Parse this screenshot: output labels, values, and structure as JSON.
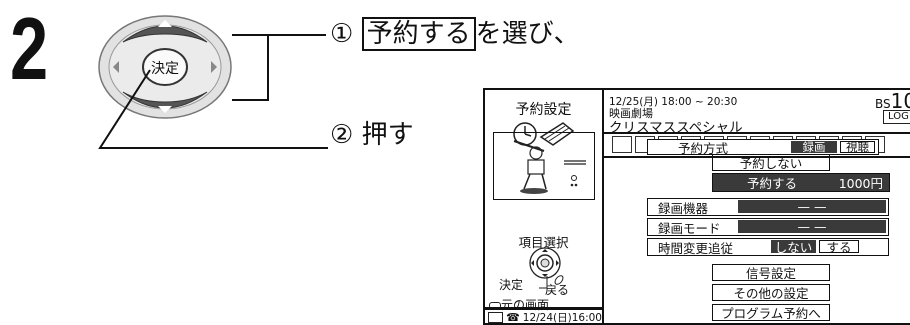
{
  "step": {
    "number": "2"
  },
  "remote": {
    "enter_label": "決定"
  },
  "instructions": {
    "line1_prefix": "①",
    "line1_boxed": "予約する",
    "line1_suffix": "を選び、",
    "line2": "② 押す"
  },
  "screen": {
    "left_title": "予約設定",
    "program": {
      "datetime": "12/25(月) 18:00 ~ 20:30",
      "genre": "映画劇場",
      "title": "クリスマススペシャル",
      "channel_prefix": "BS",
      "channel_number": "10",
      "logo": "LOG"
    },
    "side": {
      "select_label": "項目選択",
      "enter_label": "決定",
      "back_label": "戻る",
      "prev_screen": "元の画面",
      "status_time": "12/24(日)16:00"
    },
    "menu": {
      "method_label": "予約方式",
      "method_option_record": "録画",
      "method_option_view": "視聴",
      "no_reserve": "予約しない",
      "reserve": "予約する",
      "reserve_price": "1000円",
      "device_label": "録画機器",
      "device_value": "— —",
      "mode_label": "録画モード",
      "mode_value": "— —",
      "follow_label": "時間変更追従",
      "follow_off": "しない",
      "follow_on": "する",
      "signal_button": "信号設定",
      "other_button": "その他の設定",
      "program_button": "プログラム予約へ"
    }
  }
}
